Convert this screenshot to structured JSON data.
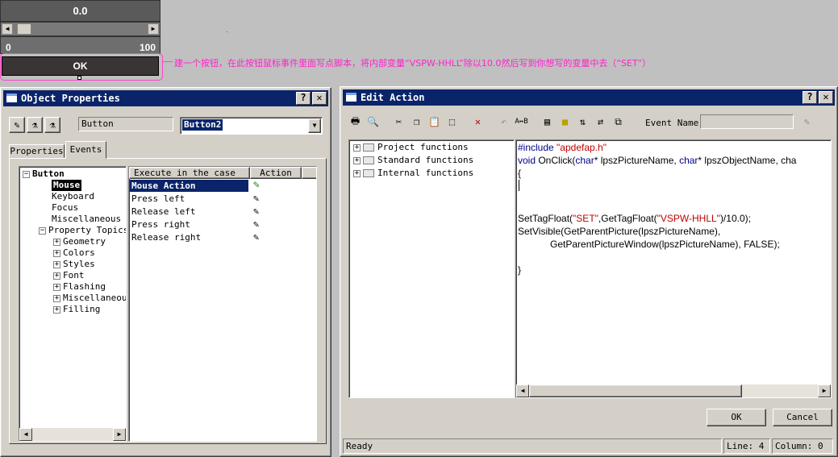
{
  "top_controls": {
    "value_display": "0.0",
    "slider": {
      "min_label": "0",
      "max_label": "100",
      "thumb_position_fraction": 0.0
    },
    "ok_button": "OK"
  },
  "annotation": "建一个按钮，在此按钮鼠标事件里面写点脚本，将内部变量“VSPW-HHLL”除以10.0然后写到你想写的变量中去（“SET”）",
  "object_properties": {
    "title": "Object Properties",
    "object_type": "Button",
    "object_name": "Button2",
    "tabs": [
      "Properties",
      "Events"
    ],
    "active_tab": "Events",
    "tree": {
      "root": "Button",
      "children": [
        "Mouse",
        "Keyboard",
        "Focus",
        "Miscellaneous"
      ],
      "property_topics": "Property Topics",
      "topic_children": [
        "Geometry",
        "Colors",
        "Styles",
        "Font",
        "Flashing",
        "Miscellaneou",
        "Filling"
      ]
    },
    "events_table": {
      "headers": [
        "Execute in the case of",
        "Action"
      ],
      "rows": [
        "Mouse Action",
        "Press left",
        "Release left",
        "Press right",
        "Release right"
      ]
    }
  },
  "edit_action": {
    "title": "Edit Action",
    "event_name_label": "Event Name:",
    "event_name_value": "",
    "function_tree": [
      "Project functions",
      "Standard functions",
      "Internal functions"
    ],
    "code_lines": {
      "l1_kw": "#include ",
      "l1_str": "\"apdefap.h\"",
      "l2_kw": "void",
      "l2_a": " OnClick(",
      "l2_kw2": "char",
      "l2_b": "* lpszPictureName, ",
      "l2_kw3": "char",
      "l2_c": "* lpszObjectName, cha",
      "l3": "{",
      "l4a": "SetTagFloat(",
      "l4_str1": "\"SET\"",
      "l4b": ",GetTagFloat(",
      "l4_str2": "\"VSPW-HHLL\"",
      "l4c": ")/10.0);",
      "l5": "SetVisible(GetParentPicture(lpszPictureName),",
      "l6": "            GetParentPictureWindow(lpszPictureName), FALSE);",
      "l7": "}"
    },
    "ok_button": "OK",
    "cancel_button": "Cancel",
    "status": "Ready",
    "line": "Line: 4",
    "column": "Column: 0"
  }
}
